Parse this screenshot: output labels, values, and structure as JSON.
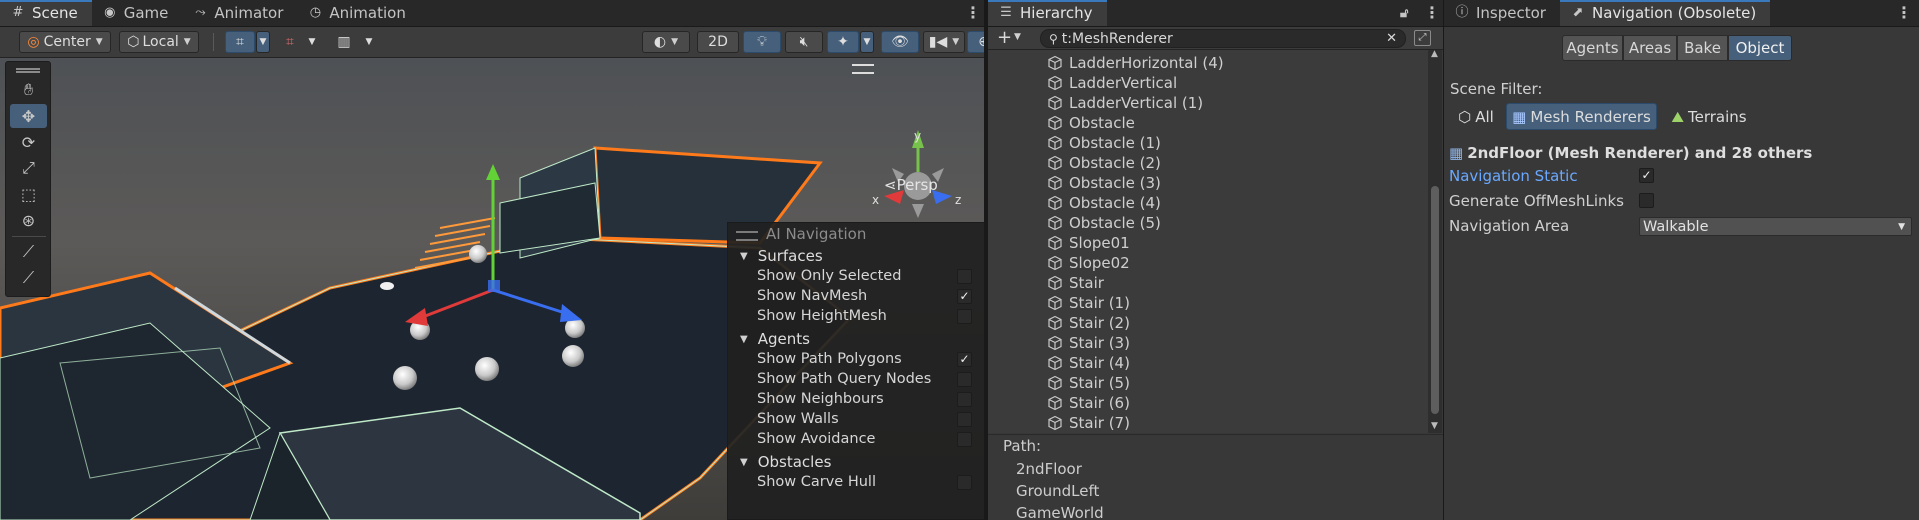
{
  "scene": {
    "tabs": [
      {
        "label": "Scene",
        "icon": "grid-icon"
      },
      {
        "label": "Game",
        "icon": "gamepad-icon"
      },
      {
        "label": "Animator",
        "icon": "animator-icon"
      },
      {
        "label": "Animation",
        "icon": "clock-icon"
      }
    ],
    "toolbar": {
      "pivot_mode": "Center",
      "pivot_rotation": "Local",
      "view_2d": "2D"
    },
    "view": {
      "persp_label": "Persp",
      "gizmo_axes": [
        "x",
        "y",
        "z"
      ]
    },
    "ai_navigation": {
      "title": "AI Navigation",
      "sections": [
        {
          "title": "Surfaces",
          "options": [
            {
              "label": "Show Only Selected",
              "checked": false
            },
            {
              "label": "Show NavMesh",
              "checked": true
            },
            {
              "label": "Show HeightMesh",
              "checked": false
            }
          ]
        },
        {
          "title": "Agents",
          "options": [
            {
              "label": "Show Path Polygons",
              "checked": true
            },
            {
              "label": "Show Path Query Nodes",
              "checked": false
            },
            {
              "label": "Show Neighbours",
              "checked": false
            },
            {
              "label": "Show Walls",
              "checked": false
            },
            {
              "label": "Show Avoidance",
              "checked": false
            }
          ]
        },
        {
          "title": "Obstacles",
          "options": [
            {
              "label": "Show Carve Hull",
              "checked": false
            }
          ]
        }
      ]
    }
  },
  "hierarchy": {
    "tab_label": "Hierarchy",
    "search_value": "t:MeshRenderer",
    "items": [
      "LadderHorizontal (4)",
      "LadderVertical",
      "LadderVertical (1)",
      "Obstacle",
      "Obstacle (1)",
      "Obstacle (2)",
      "Obstacle (3)",
      "Obstacle (4)",
      "Obstacle (5)",
      "Slope01",
      "Slope02",
      "Stair",
      "Stair (1)",
      "Stair (2)",
      "Stair (3)",
      "Stair (4)",
      "Stair (5)",
      "Stair (6)",
      "Stair (7)"
    ],
    "path_label": "Path:",
    "path": [
      "2ndFloor",
      "GroundLeft",
      "GameWorld"
    ]
  },
  "inspector": {
    "tabs": [
      {
        "label": "Inspector",
        "icon": "info-icon"
      },
      {
        "label": "Navigation (Obsolete)",
        "icon": "navigation-icon"
      }
    ],
    "mode_tabs": [
      {
        "label": "Agents",
        "selected": false
      },
      {
        "label": "Areas",
        "selected": false
      },
      {
        "label": "Bake",
        "selected": false
      },
      {
        "label": "Object",
        "selected": true
      }
    ],
    "scene_filter_label": "Scene Filter:",
    "filters": [
      {
        "label": "All",
        "selected": false
      },
      {
        "label": "Mesh Renderers",
        "selected": true
      },
      {
        "label": "Terrains",
        "selected": false
      }
    ],
    "selection_title": "2ndFloor (Mesh Renderer) and 28 others",
    "fields": {
      "navigation_static": {
        "label": "Navigation Static",
        "checked": true
      },
      "generate_offmesh": {
        "label": "Generate OffMeshLinks",
        "checked": false
      },
      "navigation_area": {
        "label": "Navigation Area",
        "value": "Walkable"
      }
    }
  },
  "colors": {
    "accent": "#46607c",
    "selection_outline": "#ff7a1a",
    "link_label": "#6aa9ff"
  }
}
